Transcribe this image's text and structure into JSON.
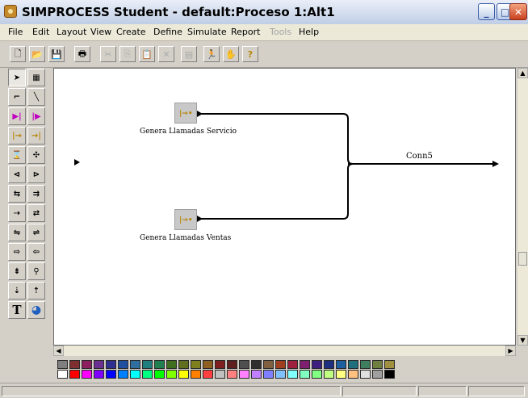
{
  "window": {
    "title": "SIMPROCESS Student - default:Proceso 1:Alt1",
    "minimize_glyph": "_",
    "maximize_glyph": "□",
    "close_glyph": "✕"
  },
  "menu": {
    "items": [
      {
        "label": "File"
      },
      {
        "label": "Edit"
      },
      {
        "label": "Layout"
      },
      {
        "label": "View"
      },
      {
        "label": "Create"
      },
      {
        "label": "Define"
      },
      {
        "label": "Simulate"
      },
      {
        "label": "Report"
      },
      {
        "label": "Tools",
        "disabled": true
      },
      {
        "label": "Help"
      }
    ]
  },
  "toolbar": {
    "buttons": [
      {
        "icon": "new-file-icon",
        "glyph": "🗋"
      },
      {
        "icon": "open-folder-icon",
        "glyph": "📂"
      },
      {
        "icon": "save-icon",
        "glyph": "💾"
      },
      {
        "icon": "print-icon",
        "glyph": "🖶"
      },
      {
        "icon": "cut-icon",
        "glyph": "✂",
        "disabled": true
      },
      {
        "icon": "copy-icon",
        "glyph": "⎘",
        "disabled": true
      },
      {
        "icon": "paste-icon",
        "glyph": "📋",
        "disabled": true
      },
      {
        "icon": "delete-icon",
        "glyph": "✕",
        "disabled": true
      },
      {
        "icon": "properties-icon",
        "glyph": "▤",
        "disabled": true
      },
      {
        "icon": "run-simulation-icon",
        "glyph": "🏃"
      },
      {
        "icon": "stop-simulation-icon",
        "glyph": "✋",
        "disabled": true
      },
      {
        "icon": "help-icon",
        "glyph": "?"
      }
    ]
  },
  "palette": {
    "tools": [
      {
        "name": "select-arrow",
        "glyph": "➤",
        "selected": true
      },
      {
        "name": "select-area",
        "glyph": "▦"
      },
      {
        "name": "connector-tool",
        "glyph": "⌐"
      },
      {
        "name": "line-tool",
        "glyph": "╲"
      },
      {
        "name": "activity-tool",
        "glyph": "▶|"
      },
      {
        "name": "process-tool",
        "glyph": "|▶"
      },
      {
        "name": "generate-tool",
        "glyph": "|→"
      },
      {
        "name": "dispose-tool",
        "glyph": "→|"
      },
      {
        "name": "delay-tool",
        "glyph": "⌛"
      },
      {
        "name": "branch-tool",
        "glyph": "✣"
      },
      {
        "name": "split-tool",
        "glyph": "⊲"
      },
      {
        "name": "join-tool",
        "glyph": "⊳"
      },
      {
        "name": "assign-tool",
        "glyph": "⇆"
      },
      {
        "name": "batch-tool",
        "glyph": "⇉"
      },
      {
        "name": "gate-tool",
        "glyph": "⇢"
      },
      {
        "name": "transform-tool",
        "glyph": "⇄"
      },
      {
        "name": "merge-tool",
        "glyph": "⇋"
      },
      {
        "name": "unbatch-tool",
        "glyph": "⇌"
      },
      {
        "name": "free-resource-tool",
        "glyph": "⇨"
      },
      {
        "name": "get-resource-tool",
        "glyph": "⇦"
      },
      {
        "name": "synchronize-tool",
        "glyph": "⇟"
      },
      {
        "name": "link-tool",
        "glyph": "⚲"
      },
      {
        "name": "hierarchy-tool",
        "glyph": "⇣"
      },
      {
        "name": "resource-tool",
        "glyph": "⇡"
      },
      {
        "name": "text-tool",
        "glyph": "T"
      },
      {
        "name": "globe-tool",
        "glyph": "◕"
      }
    ]
  },
  "diagram": {
    "nodes": [
      {
        "id": "node-1",
        "label": "Genera Llamadas Servicio",
        "glyph": "|→•"
      },
      {
        "id": "node-2",
        "label": "Genera Llamadas Ventas",
        "glyph": "|→•"
      }
    ],
    "connector_label": "Conn5"
  },
  "scrollbars": {
    "up": "▲",
    "down": "▼",
    "left": "◀",
    "right": "▶"
  },
  "colors": {
    "palette_row1": [
      "#7f7f7f",
      "#7f2f2f",
      "#8b1f5f",
      "#6a2f8f",
      "#2f2f8f",
      "#1f4f9f",
      "#2f6f9f",
      "#1f7f7f",
      "#1f7f4f",
      "#3f6f1f",
      "#5f6f1f",
      "#7f7f1f",
      "#8f5f1f",
      "#7f1f1f",
      "#5f1f1f",
      "#4f4f4f",
      "#2f2f2f",
      "#7f5f3f",
      "#9f3f1f",
      "#9f1f3f",
      "#7f1f6f",
      "#3f1f7f",
      "#1f2f7f",
      "#1f5f9f",
      "#1f6f7f",
      "#3f7f5f",
      "#6f7f3f",
      "#9f8f3f"
    ],
    "palette_row2": [
      "#ffffff",
      "#ff0000",
      "#ff00ff",
      "#8000ff",
      "#0000ff",
      "#0080ff",
      "#00ffff",
      "#00ff80",
      "#00ff00",
      "#80ff00",
      "#ffff00",
      "#ff8000",
      "#ff4040",
      "#c0c0c0",
      "#ff8080",
      "#ff80ff",
      "#c080ff",
      "#8080ff",
      "#80c0ff",
      "#80ffff",
      "#80ffc0",
      "#80ff80",
      "#c0ff80",
      "#ffff80",
      "#ffc080",
      "#e0e0e0",
      "#a0a0a0",
      "#000000"
    ],
    "canvas_bg": "#ffffff",
    "window_bg": "#d4d0c8"
  }
}
